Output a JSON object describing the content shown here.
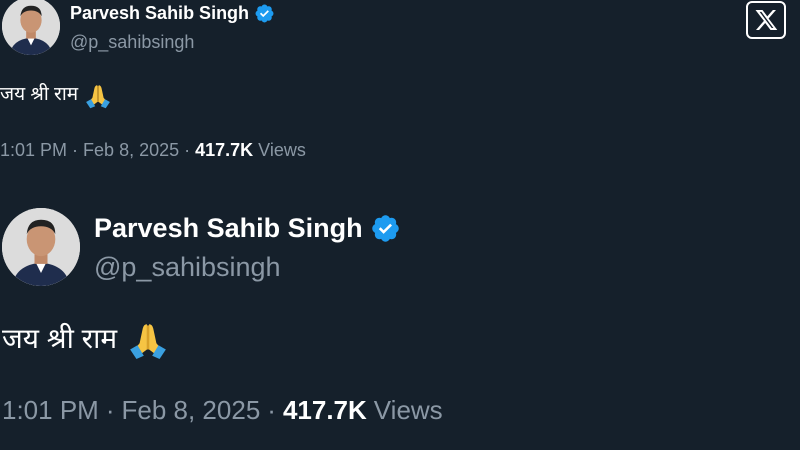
{
  "colors": {
    "background": "#15202b",
    "text_primary": "#ffffff",
    "text_secondary": "#8b98a5",
    "verified_badge": "#1d9bf0"
  },
  "tweet_small": {
    "display_name": "Parvesh Sahib Singh",
    "handle": "@p_sahibsingh",
    "text": "जय श्री राम",
    "emoji_icon": "folded-hands-icon",
    "time": "1:01 PM",
    "separator": "·",
    "date": "Feb 8, 2025",
    "views_count": "417.7K",
    "views_label": "Views"
  },
  "x_logo": {
    "icon": "x-logo-icon"
  },
  "tweet_large": {
    "display_name": "Parvesh Sahib Singh",
    "handle": "@p_sahibsingh",
    "text": "जय श्री राम",
    "emoji_icon": "folded-hands-icon",
    "time": "1:01 PM",
    "separator": "·",
    "date": "Feb 8, 2025",
    "views_count": "417.7K",
    "views_label": "Views"
  }
}
